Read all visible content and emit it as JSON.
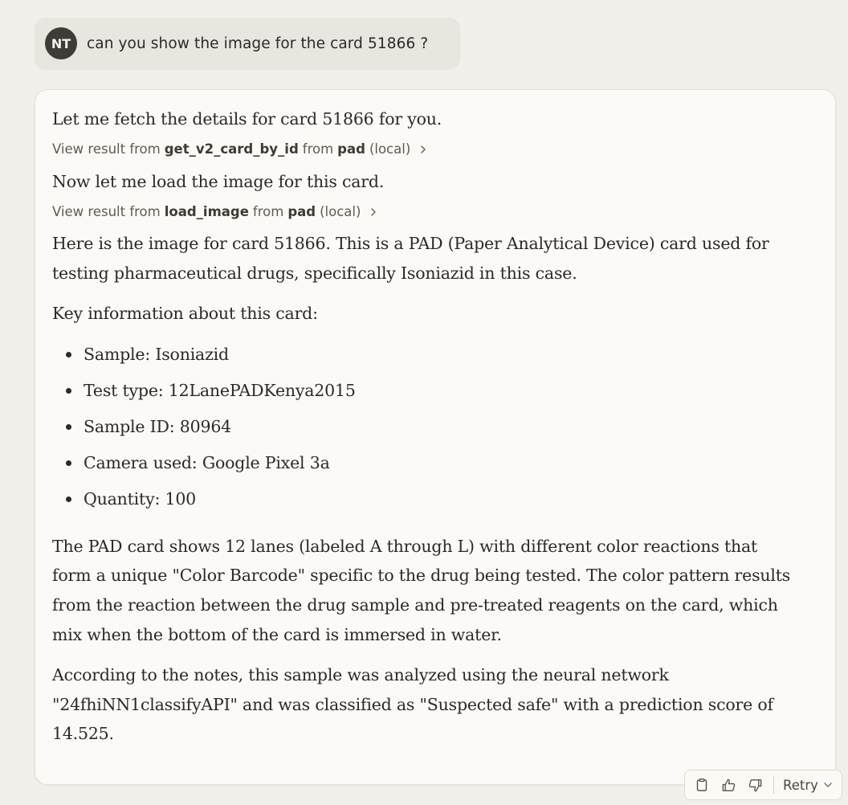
{
  "user_message": {
    "avatar_initials": "NT",
    "text": "can you show the image for the card 51866 ?"
  },
  "assistant": {
    "intro": "Let me fetch the details for card 51866 for you.",
    "tool_call_1": {
      "prefix": "View result from",
      "tool": "get_v2_card_by_id",
      "mid": "from",
      "server": "pad",
      "suffix": "(local)"
    },
    "followup": "Now let me load the image for this card.",
    "tool_call_2": {
      "prefix": "View result from",
      "tool": "load_image",
      "mid": "from",
      "server": "pad",
      "suffix": "(local)"
    },
    "paragraph_1": "Here is the image for card 51866. This is a PAD (Paper Analytical Device) card used for testing pharmaceutical drugs, specifically Isoniazid in this case.",
    "key_info_heading": "Key information about this card:",
    "key_info": [
      "Sample: Isoniazid",
      "Test type: 12LanePADKenya2015",
      "Sample ID: 80964",
      "Camera used: Google Pixel 3a",
      "Quantity: 100"
    ],
    "paragraph_2": "The PAD card shows 12 lanes (labeled A through L) with different color reactions that form a unique \"Color Barcode\" specific to the drug being tested. The color pattern results from the reaction between the drug sample and pre-treated reagents on the card, which mix when the bottom of the card is immersed in water.",
    "paragraph_3": "According to the notes, this sample was analyzed using the neural network \"24fhiNN1classifyAPI\" and was classified as \"Suspected safe\" with a prediction score of 14.525."
  },
  "actions": {
    "copy_icon": "clipboard-icon",
    "like_icon": "thumbs-up-icon",
    "dislike_icon": "thumbs-down-icon",
    "retry_label": "Retry"
  }
}
